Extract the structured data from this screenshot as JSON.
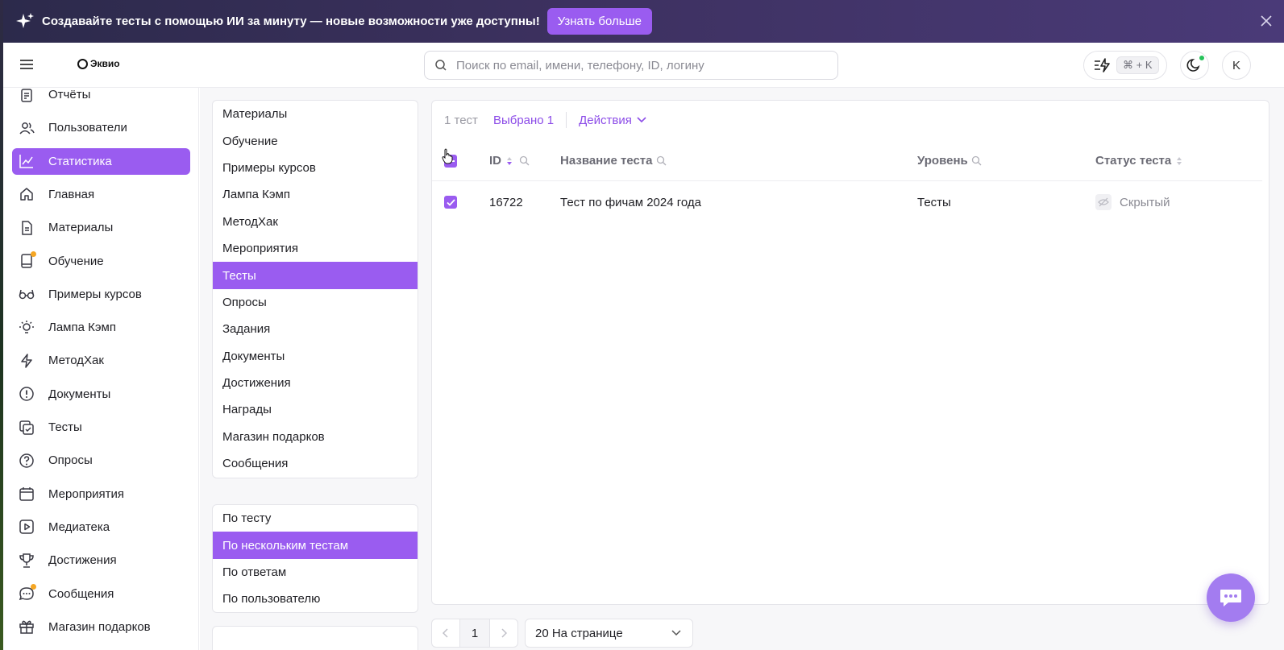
{
  "banner": {
    "text": "Создавайте тесты с помощью ИИ за минуту — новые возможности уже доступны!",
    "button_label": "Узнать больше",
    "icon": "sparkle-icon",
    "close_icon": "close-icon"
  },
  "header": {
    "logo_text": "Эквио",
    "search_placeholder": "Поиск по email, имени, телефону, ID, логину",
    "shortcut": "⌘ + K",
    "avatar_initial": "K"
  },
  "sidebar": {
    "items": [
      {
        "label": "Отчёты",
        "icon": "report-icon"
      },
      {
        "label": "Пользователи",
        "icon": "users-icon"
      },
      {
        "label": "Статистика",
        "icon": "chart-icon",
        "active": true
      },
      {
        "label": "Главная",
        "icon": "home-icon"
      },
      {
        "label": "Материалы",
        "icon": "document-icon"
      },
      {
        "label": "Обучение",
        "icon": "book-icon",
        "badge": true
      },
      {
        "label": "Примеры курсов",
        "icon": "glasses-icon"
      },
      {
        "label": "Лампа Кэмп",
        "icon": "lightbulb-icon"
      },
      {
        "label": "МетодХак",
        "icon": "lightning-icon"
      },
      {
        "label": "Документы",
        "icon": "info-circle-icon"
      },
      {
        "label": "Тесты",
        "icon": "checklist-icon"
      },
      {
        "label": "Опросы",
        "icon": "question-icon"
      },
      {
        "label": "Мероприятия",
        "icon": "calendar-icon"
      },
      {
        "label": "Медиатека",
        "icon": "play-icon"
      },
      {
        "label": "Достижения",
        "icon": "trophy-icon"
      },
      {
        "label": "Сообщения",
        "icon": "chat-icon",
        "badge": true
      },
      {
        "label": "Магазин подарков",
        "icon": "gift-icon"
      }
    ]
  },
  "categories": {
    "items": [
      "Материалы",
      "Обучение",
      "Примеры курсов",
      "Лампа Кэмп",
      "МетодХак",
      "Мероприятия",
      "Тесты",
      "Опросы",
      "Задания",
      "Документы",
      "Достижения",
      "Награды",
      "Магазин подарков",
      "Сообщения"
    ],
    "active_index": 6
  },
  "modes": {
    "items": [
      "По тесту",
      "По нескольким тестам",
      "По ответам",
      "По пользователю"
    ],
    "active_index": 1
  },
  "table": {
    "count_text": "1 тест",
    "selected_text": "Выбрано 1",
    "actions_label": "Действия",
    "headers": {
      "id": "ID",
      "name": "Название теста",
      "level": "Уровень",
      "status": "Статус теста"
    },
    "rows": [
      {
        "id": "16722",
        "name": "Тест по фичам 2024 года",
        "level": "Тесты",
        "status": "Скрытый",
        "checked": true
      }
    ]
  },
  "pagination": {
    "current_page": "1",
    "prev_icon": "chevron-left-icon",
    "next_icon": "chevron-right-icon",
    "per_page": "20 На странице"
  },
  "colors": {
    "accent": "#9a5cf0",
    "banner_bg": "#3d3160",
    "status_online": "#26c25a",
    "badge": "#f5a623"
  }
}
